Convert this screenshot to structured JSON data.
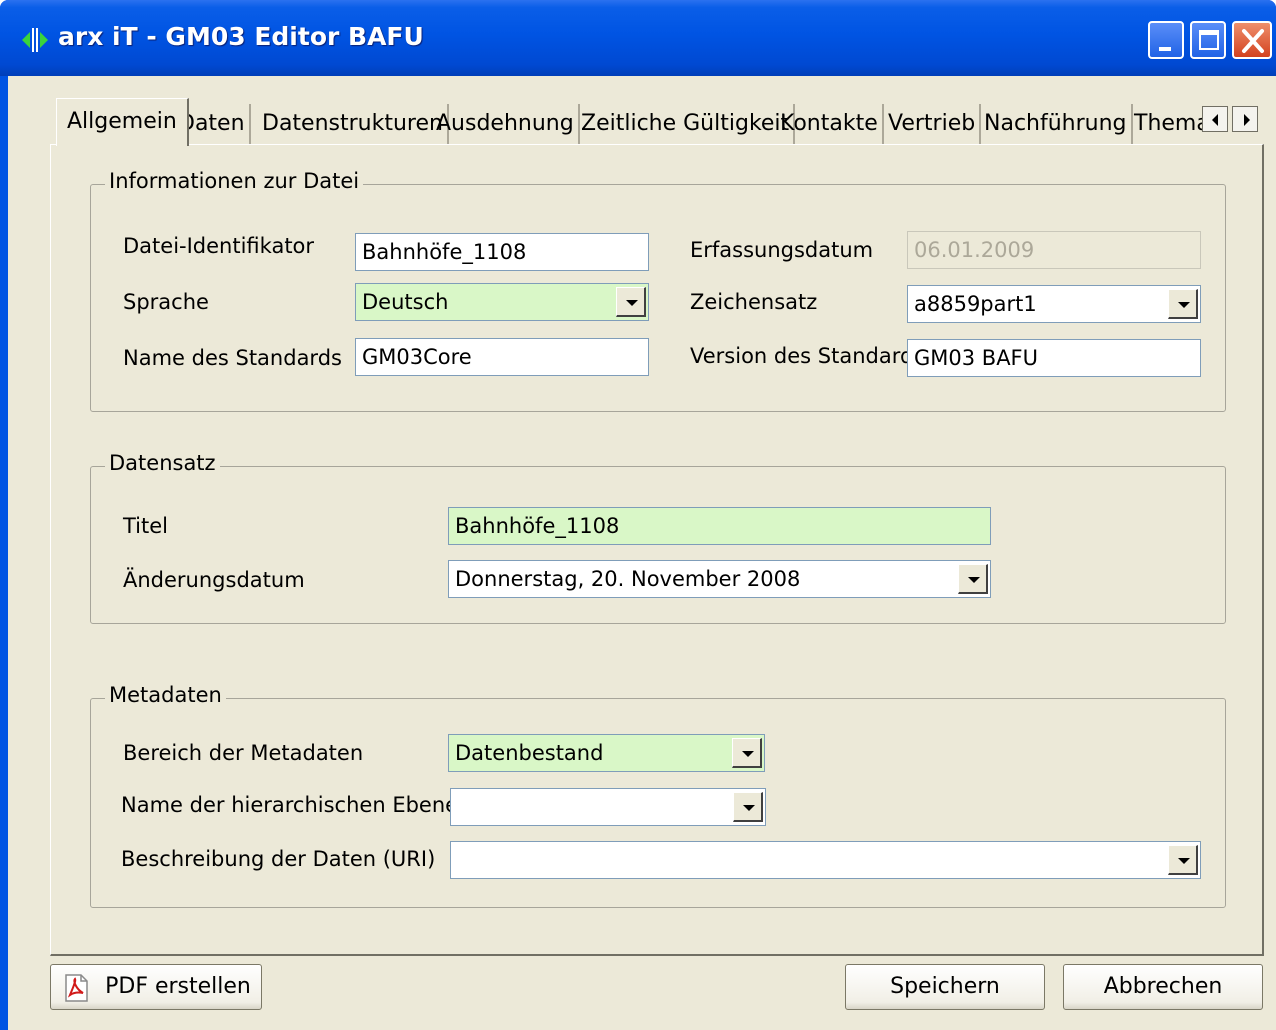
{
  "window": {
    "title": "arx iT - GM03 Editor BAFU",
    "controls": {
      "minimize_icon": "minimize-icon",
      "maximize_icon": "maximize-icon",
      "close_icon": "close-icon"
    }
  },
  "tabs": [
    {
      "label": "Allgemein",
      "active": true
    },
    {
      "label": "Daten"
    },
    {
      "label": "Datenstrukturen"
    },
    {
      "label": "Ausdehnung"
    },
    {
      "label": "Zeitliche Gültigkeit"
    },
    {
      "label": "Kontakte"
    },
    {
      "label": "Vertrieb"
    },
    {
      "label": "Nachführung"
    },
    {
      "label": "Thema"
    }
  ],
  "file_info": {
    "title": "Informationen zur Datei",
    "id_label": "Datei-Identifikator",
    "id_value": "Bahnhöfe_1108",
    "date_label": "Erfassungsdatum",
    "date_value": "06.01.2009",
    "lang_label": "Sprache",
    "lang_value": "Deutsch",
    "charset_label": "Zeichensatz",
    "charset_value": "a8859part1",
    "std_name_label": "Name des Standards",
    "std_name_value": "GM03Core",
    "std_version_label": "Version des Standards",
    "std_version_value": "GM03 BAFU"
  },
  "dataset": {
    "title": "Datensatz",
    "title_label": "Titel",
    "title_value": "Bahnhöfe_1108",
    "change_label": "Änderungsdatum",
    "change_value": "Donnerstag, 20. November 2008"
  },
  "metadata": {
    "title": "Metadaten",
    "scope_label": "Bereich der Metadaten",
    "scope_value": "Datenbestand",
    "hier_label": "Name der hierarchischen Ebene",
    "hier_value": "",
    "desc_label": "Beschreibung der Daten (URI)",
    "desc_value": ""
  },
  "buttons": {
    "pdf": "PDF erstellen",
    "save": "Speichern",
    "cancel": "Abbrechen"
  },
  "colors": {
    "required_field": "#d9f7c7",
    "titlebar": "#0054e3",
    "dialog": "#ece9d8"
  }
}
